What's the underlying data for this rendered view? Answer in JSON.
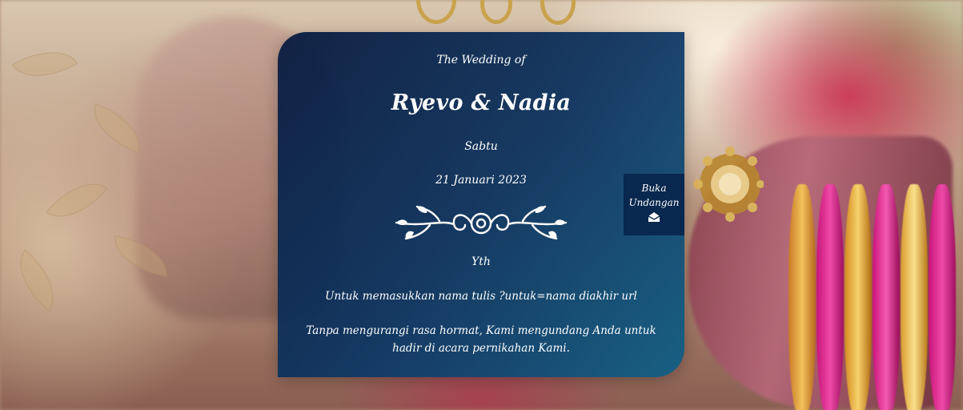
{
  "invitation": {
    "pre_title": "The Wedding of",
    "couple_names": "Ryevo & Nadia",
    "day": "Sabtu",
    "date": "21 Januari 2023",
    "recipient_label": "Yth",
    "guest_name_hint": "Untuk memasukkan nama tulis ?untuk=nama diakhir url",
    "message": "Tanpa mengurangi rasa hormat, Kami mengundang Anda untuk hadir di acara pernikahan Kami."
  },
  "open_button": {
    "label_line1": "Buka",
    "label_line2": "Undangan",
    "icon": "envelope-open-icon"
  },
  "colors": {
    "card_start": "#06193e",
    "card_end": "#0e5f87",
    "text": "#ffffff"
  }
}
